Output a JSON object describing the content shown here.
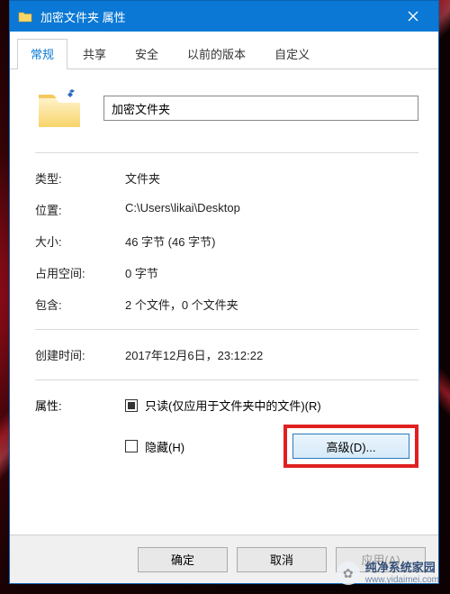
{
  "titlebar": {
    "title": "加密文件夹 属性"
  },
  "tabs": {
    "items": [
      "常规",
      "共享",
      "安全",
      "以前的版本",
      "自定义"
    ],
    "active_index": 0
  },
  "folder_name": "加密文件夹",
  "props": {
    "type_label": "类型:",
    "type_value": "文件夹",
    "location_label": "位置:",
    "location_value": "C:\\Users\\likai\\Desktop",
    "size_label": "大小:",
    "size_value": "46 字节 (46 字节)",
    "ondisk_label": "占用空间:",
    "ondisk_value": "0 字节",
    "contains_label": "包含:",
    "contains_value": "2 个文件，0 个文件夹",
    "created_label": "创建时间:",
    "created_value": "2017年12月6日，23:12:22"
  },
  "attrs": {
    "label": "属性:",
    "readonly_label": "只读(仅应用于文件夹中的文件)(R)",
    "readonly_state": "indeterminate",
    "hidden_label": "隐藏(H)",
    "hidden_state": "unchecked",
    "advanced_label": "高级(D)..."
  },
  "footer": {
    "ok": "确定",
    "cancel": "取消",
    "apply": "应用(A)"
  },
  "watermark": {
    "line1": "纯净系统家园",
    "line2": "www.yidaimei.com"
  },
  "colors": {
    "titlebar_bg": "#0a78d4",
    "highlight": "#e02020"
  }
}
